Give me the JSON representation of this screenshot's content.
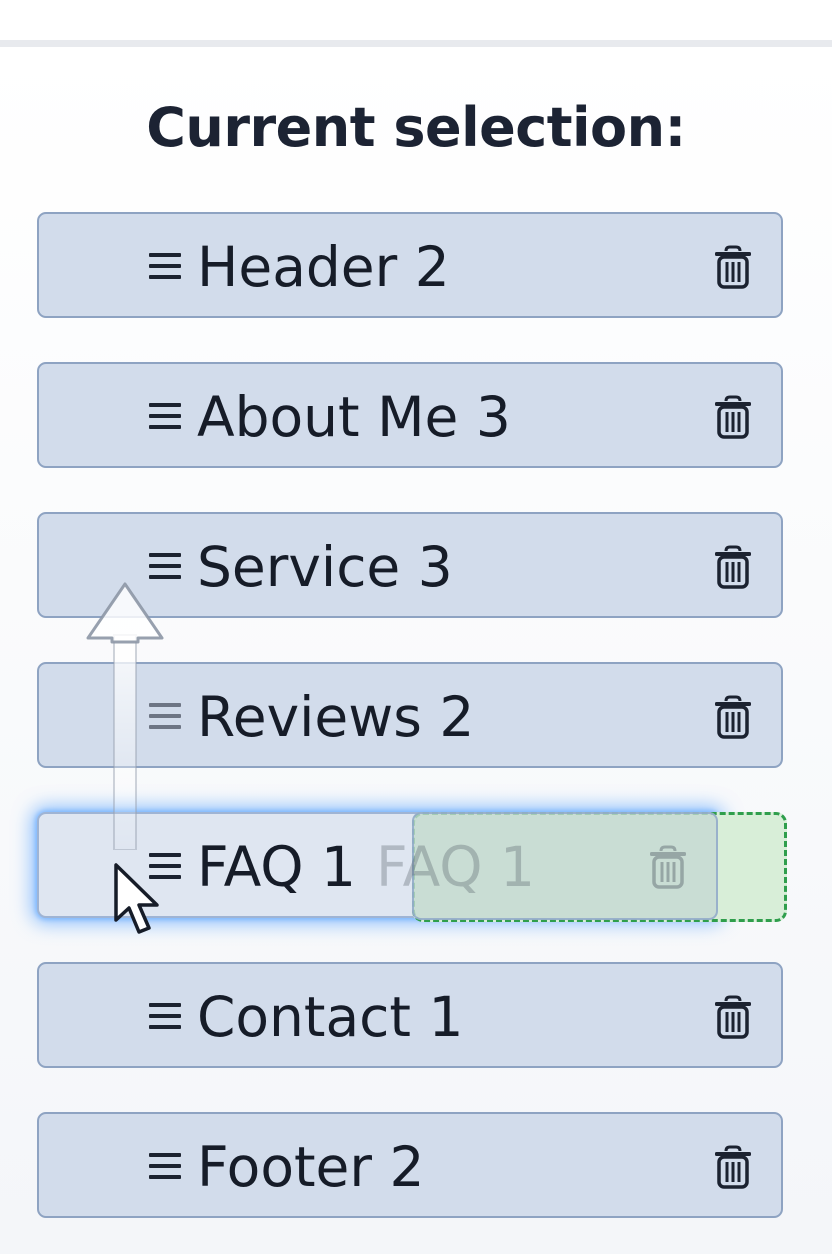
{
  "panel": {
    "title": "Current selection:"
  },
  "selection": {
    "items": [
      {
        "label": "Header 2"
      },
      {
        "label": "About Me 3"
      },
      {
        "label": "Service 3"
      },
      {
        "label": "Reviews 2"
      },
      {
        "label": "FAQ 1"
      },
      {
        "label": "Contact 1"
      },
      {
        "label": "Footer 2"
      }
    ],
    "dragging": {
      "label": "FAQ 1"
    }
  },
  "icons": {
    "handle": "drag-handle-icon",
    "delete": "trash-icon",
    "cursor": "mouse-pointer-icon",
    "drag_direction": "arrow-up-icon"
  },
  "colors": {
    "item_bg": "#d2dceb",
    "item_border": "#8ea3c2",
    "drag_glow": "#4096ff",
    "drop_zone": "#2f9e4c"
  }
}
